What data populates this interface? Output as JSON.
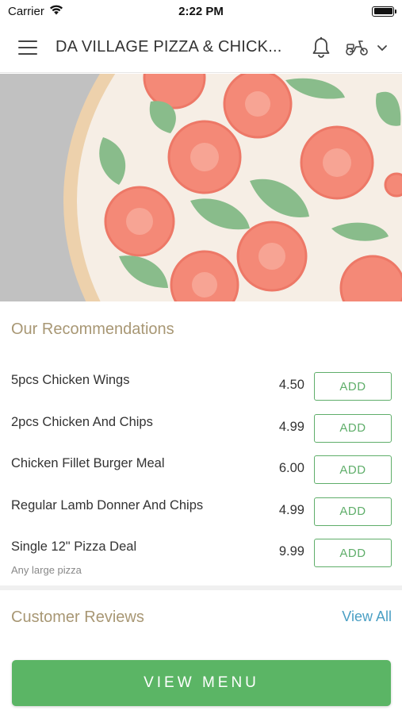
{
  "status_bar": {
    "carrier": "Carrier",
    "time": "2:22 PM"
  },
  "header": {
    "store_title": "DA VILLAGE PIZZA & CHICK...",
    "icons": [
      "menu-icon",
      "bell-icon",
      "scooter-icon",
      "chevron-down-icon"
    ]
  },
  "hero": {
    "image": "pizza-image"
  },
  "recommendations": {
    "title": "Our Recommendations",
    "items": [
      {
        "name": "5pcs Chicken Wings",
        "subtitle": "",
        "price": "4.50",
        "add_label": "ADD"
      },
      {
        "name": "2pcs Chicken And Chips",
        "subtitle": "",
        "price": "4.99",
        "add_label": "ADD"
      },
      {
        "name": "Chicken Fillet Burger Meal",
        "subtitle": "",
        "price": "6.00",
        "add_label": "ADD"
      },
      {
        "name": "Regular Lamb Donner And Chips",
        "subtitle": "",
        "price": "4.99",
        "add_label": "ADD"
      },
      {
        "name": "Single 12\" Pizza Deal",
        "subtitle": "Any large pizza",
        "price": "9.99",
        "add_label": "ADD"
      }
    ]
  },
  "reviews": {
    "title": "Customer Reviews",
    "view_all": "View All"
  },
  "footer": {
    "view_menu": "VIEW MENU"
  },
  "colors": {
    "accent_green": "#5bb565",
    "section_title": "#a89774",
    "link_blue": "#4a9fc4"
  }
}
